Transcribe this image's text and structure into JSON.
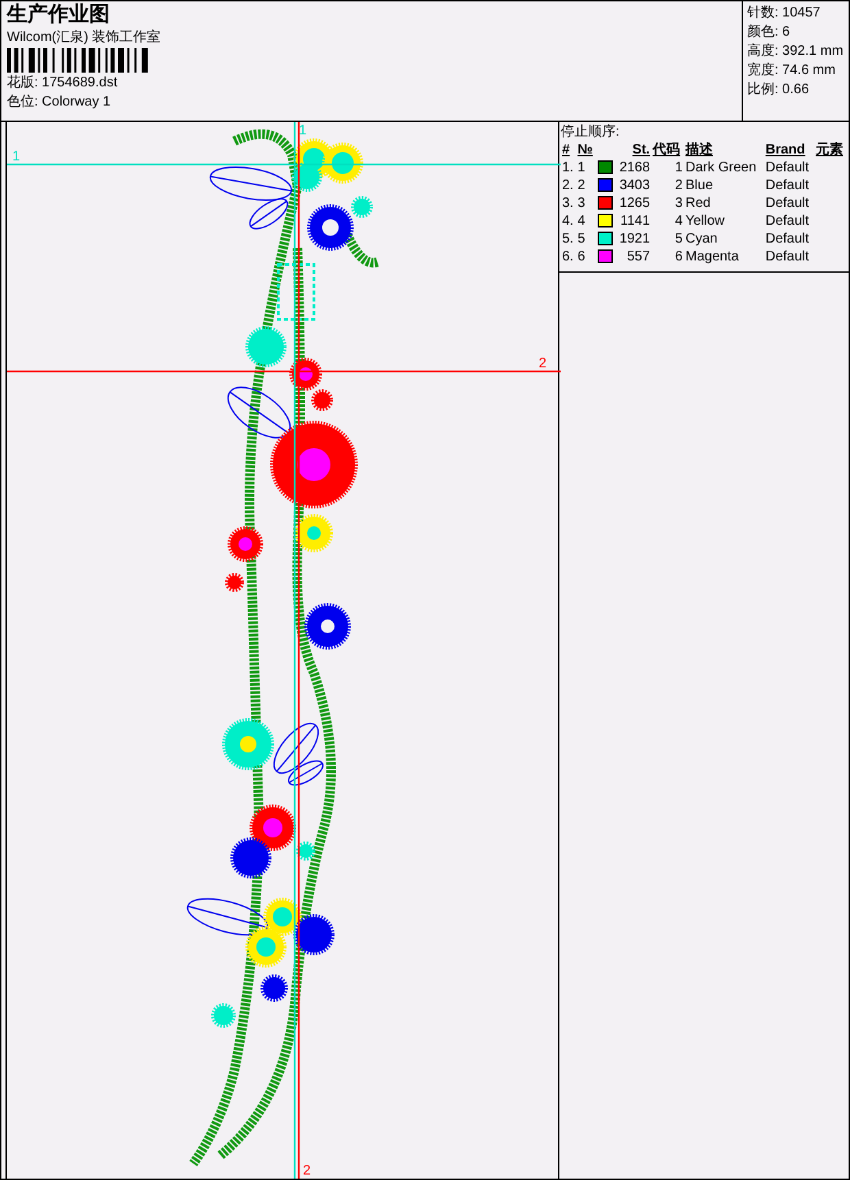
{
  "header": {
    "title": "生产作业图",
    "company": "Wilcom(汇泉) 装饰工作室",
    "design_file": "花版: 1754689.dst",
    "colorway": "色位: Colorway 1"
  },
  "stats": [
    "针数: 10457",
    "颜色: 6",
    "高度: 392.1 mm",
    "宽度: 74.6 mm",
    "比例: 0.66"
  ],
  "stop_sequence": {
    "title": "停止顺序:",
    "columns": [
      "#",
      "№",
      "St.",
      "代码",
      "描述",
      "Brand",
      "元素"
    ],
    "rows": [
      {
        "index": "1.",
        "number": "1",
        "color": "#008800",
        "stitches": "2168",
        "code": "1",
        "description": "Dark Green",
        "brand": "Default"
      },
      {
        "index": "2.",
        "number": "2",
        "color": "#0000ff",
        "stitches": "3403",
        "code": "2",
        "description": "Blue",
        "brand": "Default"
      },
      {
        "index": "3.",
        "number": "3",
        "color": "#ff0000",
        "stitches": "1265",
        "code": "3",
        "description": "Red",
        "brand": "Default"
      },
      {
        "index": "4.",
        "number": "4",
        "color": "#ffff00",
        "stitches": "1141",
        "code": "4",
        "description": "Yellow",
        "brand": "Default"
      },
      {
        "index": "5.",
        "number": "5",
        "color": "#00f0c8",
        "stitches": "1921",
        "code": "5",
        "description": "Cyan",
        "brand": "Default"
      },
      {
        "index": "6.",
        "number": "6",
        "color": "#ff00ff",
        "stitches": "557",
        "code": "6",
        "description": "Magenta",
        "brand": "Default"
      }
    ]
  },
  "horizontal_guides": [
    {
      "label": "1",
      "color": "#00e0c0"
    },
    {
      "label": "2",
      "color": "#ff0000"
    }
  ],
  "vertical_guides": [
    {
      "label": "1",
      "color": "#00e0c0"
    },
    {
      "label": "2",
      "color": "#ff0000"
    }
  ]
}
